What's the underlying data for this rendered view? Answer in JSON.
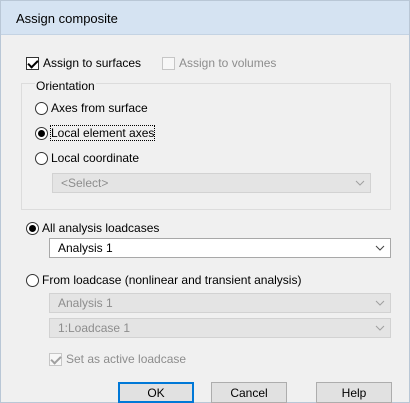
{
  "window": {
    "title": "Assign composite"
  },
  "targets": {
    "assign_to_surfaces": {
      "label": "Assign to surfaces",
      "checked": true
    },
    "assign_to_volumes": {
      "label": "Assign to volumes",
      "checked": false,
      "disabled": true
    }
  },
  "orientation": {
    "title": "Orientation",
    "options": [
      {
        "label": "Axes from surface",
        "selected": false
      },
      {
        "label": "Local element axes",
        "selected": true
      },
      {
        "label": "Local coordinate",
        "selected": false
      }
    ],
    "coordinate_select": {
      "value": "<Select>",
      "disabled": true
    }
  },
  "loadcase_source": {
    "all_analysis": {
      "label": "All analysis loadcases",
      "selected": true
    },
    "analysis_select": {
      "value": "Analysis 1",
      "disabled": false
    },
    "from_loadcase": {
      "label": "From loadcase (nonlinear and transient analysis)",
      "selected": false
    },
    "from_analysis_select": {
      "value": "Analysis 1",
      "disabled": true
    },
    "loadcase_select": {
      "value": "1:Loadcase 1",
      "disabled": true
    },
    "set_active": {
      "label": "Set as active loadcase",
      "checked": true,
      "disabled": true
    }
  },
  "buttons": {
    "ok": "OK",
    "cancel": "Cancel",
    "help": "Help"
  },
  "icons": {
    "dropdown": "chevron-down-icon"
  },
  "colors": {
    "title_bar": "#d5e3f2",
    "dialog_bg": "#f0f0f0",
    "default_button_border": "#0078d7"
  }
}
